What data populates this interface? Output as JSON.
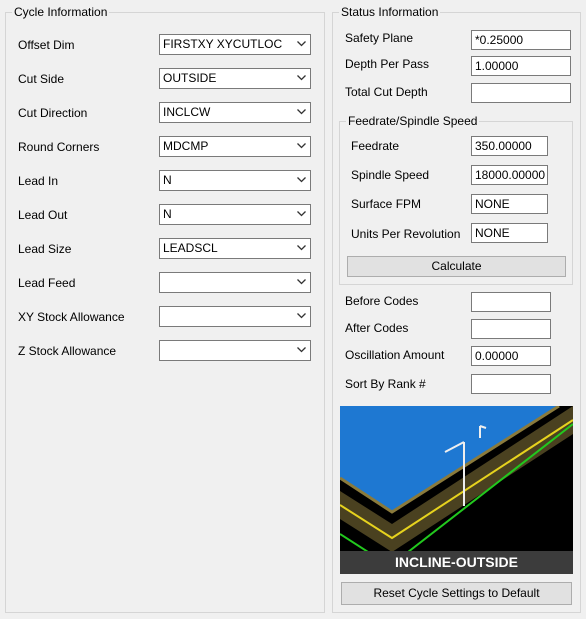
{
  "cycle_info": {
    "title": "Cycle Information",
    "fields": [
      {
        "label": "Offset Dim",
        "value": "FIRSTXY XYCUTLOC"
      },
      {
        "label": "Cut Side",
        "value": "OUTSIDE"
      },
      {
        "label": "Cut Direction",
        "value": "INCLCW"
      },
      {
        "label": "Round Corners",
        "value": "MDCMP"
      },
      {
        "label": "Lead In",
        "value": "N"
      },
      {
        "label": "Lead Out",
        "value": "N"
      },
      {
        "label": "Lead Size",
        "value": "LEADSCL"
      },
      {
        "label": "Lead Feed",
        "value": ""
      },
      {
        "label": "XY Stock Allowance",
        "value": ""
      },
      {
        "label": "Z Stock Allowance",
        "value": ""
      }
    ]
  },
  "status_info": {
    "title": "Status Information",
    "safety_plane": {
      "label": "Safety Plane",
      "value": "*0.25000"
    },
    "depth_per_pass": {
      "label": "Depth Per Pass",
      "value": "1.00000"
    },
    "total_cut_depth": {
      "label": "Total Cut Depth",
      "value": ""
    },
    "feedrate_group": {
      "title": "Feedrate/Spindle Speed",
      "feedrate": {
        "label": "Feedrate",
        "value": "350.00000"
      },
      "spindle_speed": {
        "label": "Spindle Speed",
        "value": "18000.00000"
      },
      "surface_fpm": {
        "label": "Surface FPM",
        "value": "NONE"
      },
      "units_per_rev": {
        "label": "Units Per Revolution",
        "value": "NONE"
      },
      "calculate_label": "Calculate"
    },
    "before_codes": {
      "label": "Before Codes",
      "value": ""
    },
    "after_codes": {
      "label": "After Codes",
      "value": ""
    },
    "oscillation_amount": {
      "label": "Oscillation Amount",
      "value": "0.00000"
    },
    "sort_by_rank": {
      "label": "Sort By Rank #",
      "value": ""
    },
    "preview_caption": "INCLINE-OUTSIDE",
    "reset_label": "Reset Cycle Settings to Default"
  },
  "colors": {
    "surface_blue": "#1e78d2",
    "wall_brown": "#4a4120",
    "edge_yellow": "#e6d21e",
    "path_green": "#22c81e"
  }
}
